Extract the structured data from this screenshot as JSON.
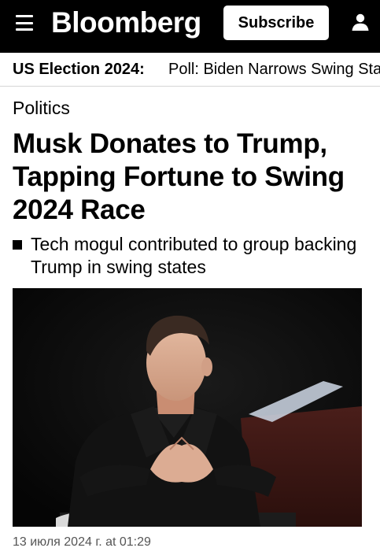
{
  "header": {
    "logo": "Bloomberg",
    "subscribe_label": "Subscribe"
  },
  "ticker": {
    "label": "US Election 2024:",
    "headline": "Poll: Biden Narrows Swing States Gap"
  },
  "article": {
    "category": "Politics",
    "headline": "Musk Donates to Trump, Tapping Fortune to Swing 2024 Race",
    "summary": "Tech mogul contributed to group backing Trump in swing states",
    "timestamp": "13 июля 2024 г. at 01:29"
  },
  "colors": {
    "header_bg": "#000000",
    "accent": "#ffffff",
    "timestamp": "#555555"
  }
}
